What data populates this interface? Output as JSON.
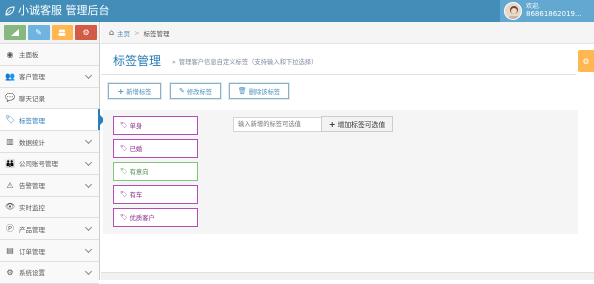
{
  "navbar": {
    "brand": "小诚客服 管理后台",
    "user_greeting": "欢迎,",
    "user_id": "86861862019..."
  },
  "shortcuts": [
    {
      "icon": "signal-icon",
      "color": "#87b87f"
    },
    {
      "icon": "pencil-icon",
      "color": "#6fb3e0"
    },
    {
      "icon": "users-icon",
      "color": "#ffb752"
    },
    {
      "icon": "cogs-icon",
      "color": "#d15b47"
    }
  ],
  "sidebar": {
    "items": [
      {
        "label": "主面板",
        "icon": "dashboard-icon",
        "glyph": "◉",
        "has_arrow": false
      },
      {
        "label": "客户管理",
        "icon": "users-icon",
        "glyph": "👥",
        "has_arrow": true
      },
      {
        "label": "聊天记录",
        "icon": "comments-icon",
        "glyph": "💬",
        "has_arrow": false
      },
      {
        "label": "标签管理",
        "icon": "tag-icon",
        "glyph": "🏷",
        "has_arrow": false,
        "active": true
      },
      {
        "label": "数据统计",
        "icon": "bar-chart-icon",
        "glyph": "▥",
        "has_arrow": true
      },
      {
        "label": "公司账号管理",
        "icon": "user-group-icon",
        "glyph": "👪",
        "has_arrow": true
      },
      {
        "label": "告警管理",
        "icon": "warning-icon",
        "glyph": "⚠",
        "has_arrow": true
      },
      {
        "label": "实时监控",
        "icon": "eye-icon",
        "glyph": "👁",
        "has_arrow": false
      },
      {
        "label": "产品管理",
        "icon": "product-icon",
        "glyph": "Ⓟ",
        "has_arrow": true
      },
      {
        "label": "订单管理",
        "icon": "order-icon",
        "glyph": "▤",
        "has_arrow": true
      },
      {
        "label": "系统设置",
        "icon": "settings-icon",
        "glyph": "⚙",
        "has_arrow": true
      }
    ]
  },
  "breadcrumb": {
    "home": "主页",
    "separator": ">",
    "current": "标签管理"
  },
  "page": {
    "title": "标签管理",
    "subtitle_prefix": "»",
    "subtitle": "管理客户信息自定义标签（支持输入和下拉选择）"
  },
  "toolbar": {
    "new_label": "新增标签",
    "edit_label": "修改标签",
    "delete_label": "删除该标签"
  },
  "tags": [
    {
      "label": "单身",
      "style": "purple"
    },
    {
      "label": "已婚",
      "style": "purple"
    },
    {
      "label": "有意向",
      "style": "green"
    },
    {
      "label": "有车",
      "style": "purple"
    },
    {
      "label": "优质客户",
      "style": "purple"
    }
  ],
  "option_input": {
    "placeholder": "输入新增的标签可选值",
    "button_label": "增加标签可选值"
  },
  "colors": {
    "navbar": "#438eb9",
    "accent": "#2b7dbc",
    "tag_purple": "#b34db5",
    "tag_green": "#80c57c"
  }
}
